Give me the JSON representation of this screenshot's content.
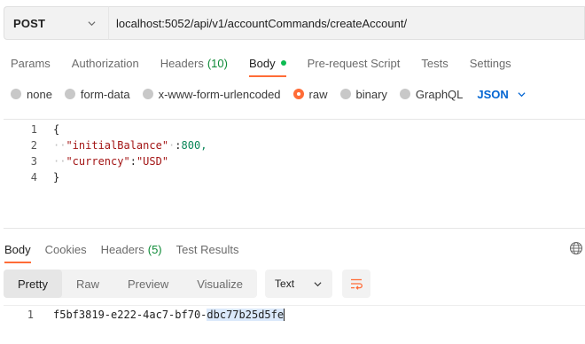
{
  "request": {
    "method": "POST",
    "url": "localhost:5052/api/v1/accountCommands/createAccount/"
  },
  "request_tabs": [
    {
      "label": "Params"
    },
    {
      "label": "Authorization"
    },
    {
      "label": "Headers",
      "count": "(10)"
    },
    {
      "label": "Body",
      "active": true
    },
    {
      "label": "Pre-request Script"
    },
    {
      "label": "Tests"
    },
    {
      "label": "Settings"
    }
  ],
  "body_types": {
    "none": "none",
    "form_data": "form-data",
    "urlencoded": "x-www-form-urlencoded",
    "raw": "raw",
    "binary": "binary",
    "graphql": "GraphQL",
    "selected": "raw",
    "language": "JSON"
  },
  "editor": {
    "lines": [
      {
        "num": "1",
        "text": "{"
      },
      {
        "num": "2",
        "key": "\"initialBalance\"",
        "sep": ":",
        "value": "800,"
      },
      {
        "num": "3",
        "key": "\"currency\"",
        "sep": ":",
        "value": "\"USD\""
      },
      {
        "num": "4",
        "text": "}"
      }
    ]
  },
  "response_tabs": [
    {
      "label": "Body",
      "active": true
    },
    {
      "label": "Cookies"
    },
    {
      "label": "Headers",
      "count": "(5)"
    },
    {
      "label": "Test Results"
    }
  ],
  "view_modes": {
    "pretty": "Pretty",
    "raw": "Raw",
    "preview": "Preview",
    "visualize": "Visualize",
    "active": "Pretty"
  },
  "format": "Text",
  "response_body": {
    "line_num": "1",
    "text_plain": "f5bf3819-e222-4ac7-bf70-",
    "text_selected": "dbc77b25d5fe"
  },
  "colors": {
    "accent": "#ff6c37",
    "json_blue": "#0265d2",
    "count_green": "#0d8a36",
    "dot_green": "#0cbb52"
  }
}
